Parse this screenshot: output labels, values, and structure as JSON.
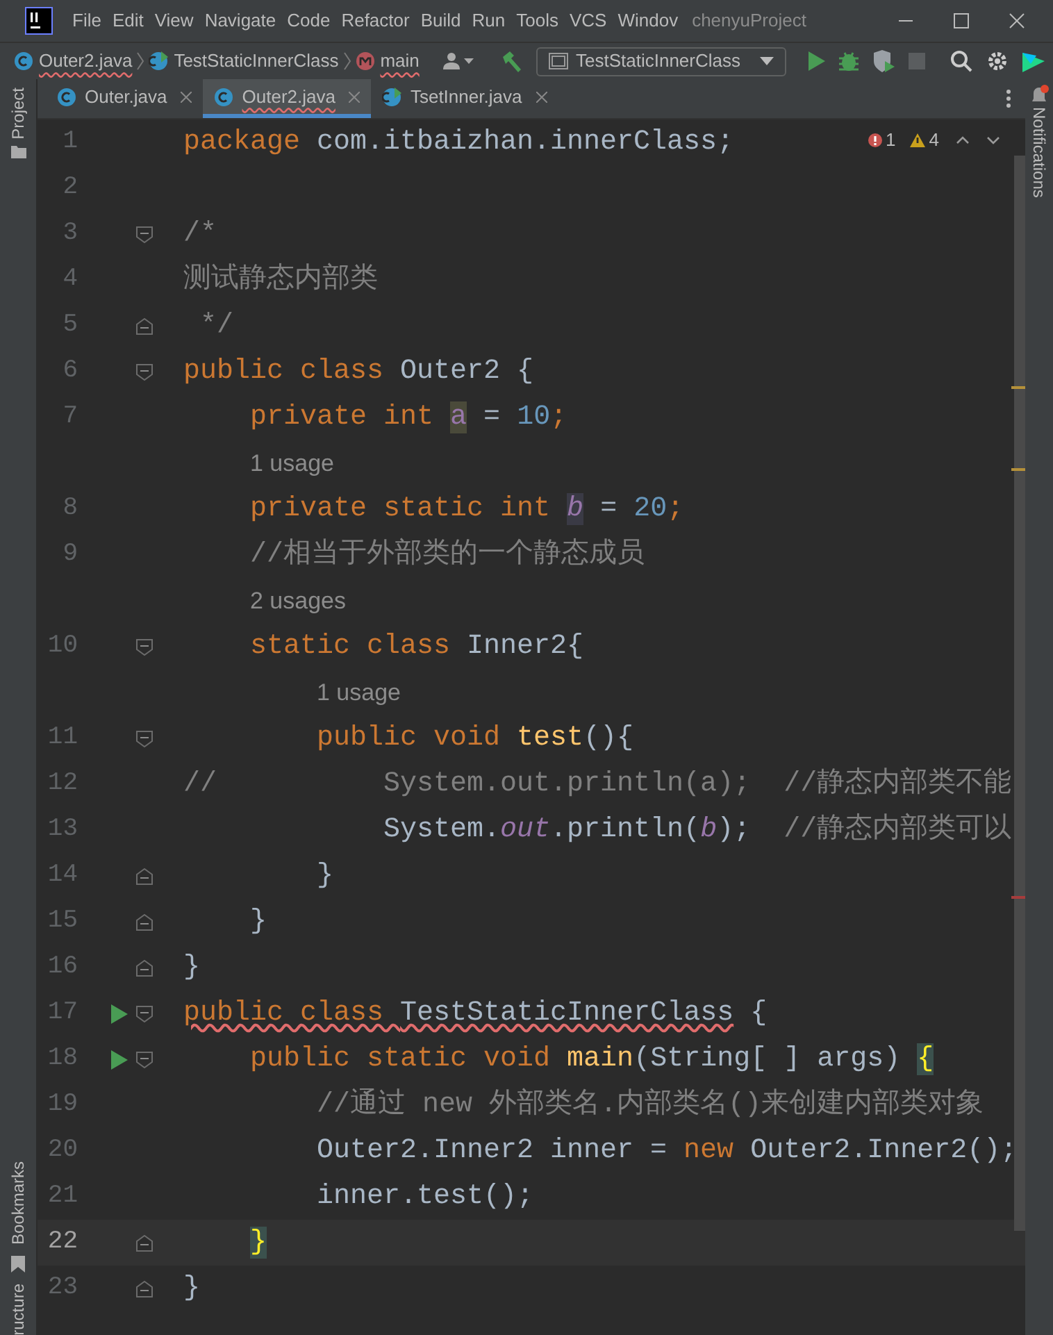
{
  "menu": [
    "File",
    "Edit",
    "View",
    "Navigate",
    "Code",
    "Refactor",
    "Build",
    "Run",
    "Tools",
    "VCS",
    "Windov"
  ],
  "window": {
    "title": "chenyuProject"
  },
  "breadcrumbs": [
    {
      "kind": "class",
      "text": "Outer2.java",
      "error": true
    },
    {
      "kind": "runnable",
      "text": "TestStaticInnerClass",
      "error": false
    },
    {
      "kind": "method",
      "text": "main",
      "error": true
    }
  ],
  "run_config": "TestStaticInnerClass",
  "tabs": [
    {
      "label": "Outer.java",
      "kind": "class",
      "selected": false,
      "error": false
    },
    {
      "label": "Outer2.java",
      "kind": "class",
      "selected": true,
      "error": true
    },
    {
      "label": "TsetInner.java",
      "kind": "runnable",
      "selected": false,
      "error": false
    }
  ],
  "left_tools": [
    "Project"
  ],
  "left_tools_bottom": [
    "Bookmarks",
    "ructure"
  ],
  "right_tools": [
    "Notifications"
  ],
  "inspections": {
    "errors": "1",
    "warnings": "4"
  },
  "rows": [
    {
      "kind": "code",
      "number": "1",
      "current": false,
      "runnable": false,
      "fold_open": false,
      "fold_close": false,
      "tokens": [
        {
          "kind": "kw",
          "text": "package "
        },
        {
          "kind": "id",
          "text": "com.itbaizhan.innerClass;"
        }
      ]
    },
    {
      "kind": "code",
      "number": "2",
      "current": false,
      "runnable": false,
      "fold_open": false,
      "fold_close": false
    },
    {
      "kind": "code",
      "number": "3",
      "current": false,
      "runnable": false,
      "fold_open": true,
      "fold_close": false,
      "tokens": [
        {
          "kind": "cmt",
          "text": "/*"
        }
      ]
    },
    {
      "kind": "code",
      "number": "4",
      "current": false,
      "runnable": false,
      "fold_open": false,
      "fold_close": false,
      "tokens": [
        {
          "kind": "cmt",
          "text": "测试静态内部类"
        }
      ]
    },
    {
      "kind": "code",
      "number": "5",
      "current": false,
      "runnable": false,
      "fold_open": false,
      "fold_close": true,
      "tokens": [
        {
          "kind": "cmt",
          "text": " */"
        }
      ]
    },
    {
      "kind": "code",
      "number": "6",
      "current": false,
      "runnable": false,
      "fold_open": true,
      "fold_close": false,
      "tokens": [
        {
          "kind": "kw",
          "text": "public class "
        },
        {
          "kind": "id",
          "text": "Outer2 {"
        }
      ]
    },
    {
      "kind": "code",
      "number": "7",
      "current": false,
      "runnable": false,
      "fold_open": false,
      "fold_close": false,
      "tokens": [
        {
          "kind": "kw",
          "text": "    private int "
        },
        {
          "kind": "field_hl",
          "text": "a"
        },
        {
          "kind": "id",
          "text": " = "
        },
        {
          "kind": "num",
          "text": "10"
        },
        {
          "kind": "kw",
          "text": ";"
        }
      ]
    },
    {
      "kind": "hint",
      "text": "1 usage"
    },
    {
      "kind": "code",
      "number": "8",
      "current": false,
      "runnable": false,
      "fold_open": false,
      "fold_close": false,
      "tokens": [
        {
          "kind": "kw",
          "text": "    private static int "
        },
        {
          "kind": "static_hl",
          "text": "b"
        },
        {
          "kind": "id",
          "text": " = "
        },
        {
          "kind": "num",
          "text": "20"
        },
        {
          "kind": "kw",
          "text": ";"
        }
      ]
    },
    {
      "kind": "code",
      "number": "9",
      "current": false,
      "runnable": false,
      "fold_open": false,
      "fold_close": false,
      "tokens": [
        {
          "kind": "cmt",
          "text": "    //相当于外部类的一个静态成员"
        }
      ]
    },
    {
      "kind": "hint",
      "text": "2 usages"
    },
    {
      "kind": "code",
      "number": "10",
      "current": false,
      "runnable": false,
      "fold_open": true,
      "fold_close": false,
      "tokens": [
        {
          "kind": "kw",
          "text": "    static class "
        },
        {
          "kind": "id",
          "text": "Inner2{"
        }
      ]
    },
    {
      "kind": "hint",
      "text": "1 usage"
    },
    {
      "kind": "code",
      "number": "11",
      "current": false,
      "runnable": false,
      "fold_open": true,
      "fold_close": false,
      "tokens": [
        {
          "kind": "kw",
          "text": "        public void "
        },
        {
          "kind": "method",
          "text": "test"
        },
        {
          "kind": "id",
          "text": "(){"
        }
      ]
    },
    {
      "kind": "code",
      "number": "12",
      "current": false,
      "runnable": false,
      "fold_open": false,
      "fold_close": false,
      "tokens": [
        {
          "kind": "cmt",
          "text": "//          System.out.println(a);  //静态内部类不能"
        }
      ]
    },
    {
      "kind": "code",
      "number": "13",
      "current": false,
      "runnable": false,
      "fold_open": false,
      "fold_close": false,
      "tokens": [
        {
          "kind": "id",
          "text": "            System."
        },
        {
          "kind": "static_field",
          "text": "out"
        },
        {
          "kind": "id",
          "text": ".println("
        },
        {
          "kind": "static",
          "text": "b"
        },
        {
          "kind": "id",
          "text": ");  "
        },
        {
          "kind": "cmt",
          "text": "//静态内部类可以"
        }
      ]
    },
    {
      "kind": "code",
      "number": "14",
      "current": false,
      "runnable": false,
      "fold_open": false,
      "fold_close": true,
      "tokens": [
        {
          "kind": "id",
          "text": "        }"
        }
      ]
    },
    {
      "kind": "code",
      "number": "15",
      "current": false,
      "runnable": false,
      "fold_open": false,
      "fold_close": true,
      "tokens": [
        {
          "kind": "id",
          "text": "    }"
        }
      ]
    },
    {
      "kind": "code",
      "number": "16",
      "current": false,
      "runnable": false,
      "fold_open": false,
      "fold_close": true,
      "tokens": [
        {
          "kind": "id",
          "text": "}"
        }
      ]
    },
    {
      "kind": "code",
      "number": "17",
      "current": false,
      "runnable": true,
      "fold_open": true,
      "fold_close": false,
      "tokens": [
        {
          "kind": "kw_err",
          "text": "public class "
        },
        {
          "kind": "id_err",
          "text": "TestStaticInnerClass"
        },
        {
          "kind": "id",
          "text": " {"
        }
      ]
    },
    {
      "kind": "code",
      "number": "18",
      "current": false,
      "runnable": true,
      "fold_open": true,
      "fold_close": false,
      "tokens": [
        {
          "kind": "kw",
          "text": "    public static void "
        },
        {
          "kind": "method",
          "text": "main"
        },
        {
          "kind": "id",
          "text": "(String[ ] args) "
        },
        {
          "kind": "brace",
          "text": "{"
        }
      ]
    },
    {
      "kind": "code",
      "number": "19",
      "current": false,
      "runnable": false,
      "fold_open": false,
      "fold_close": false,
      "tokens": [
        {
          "kind": "cmt",
          "text": "        //通过 new 外部类名.内部类名()来创建内部类对象"
        }
      ]
    },
    {
      "kind": "code",
      "number": "20",
      "current": false,
      "runnable": false,
      "fold_open": false,
      "fold_close": false,
      "tokens": [
        {
          "kind": "id",
          "text": "        Outer2.Inner2 inner = "
        },
        {
          "kind": "kw",
          "text": "new "
        },
        {
          "kind": "id",
          "text": "Outer2.Inner2();"
        }
      ]
    },
    {
      "kind": "code",
      "number": "21",
      "current": false,
      "runnable": false,
      "fold_open": false,
      "fold_close": false,
      "tokens": [
        {
          "kind": "id",
          "text": "        inner.test();"
        }
      ]
    },
    {
      "kind": "code",
      "number": "22",
      "current": true,
      "runnable": false,
      "fold_open": false,
      "fold_close": true,
      "tokens": [
        {
          "kind": "brace",
          "text": "    }"
        }
      ]
    },
    {
      "kind": "code",
      "number": "23",
      "current": false,
      "runnable": false,
      "fold_open": false,
      "fold_close": true,
      "tokens": [
        {
          "kind": "id",
          "text": "}"
        }
      ]
    }
  ]
}
